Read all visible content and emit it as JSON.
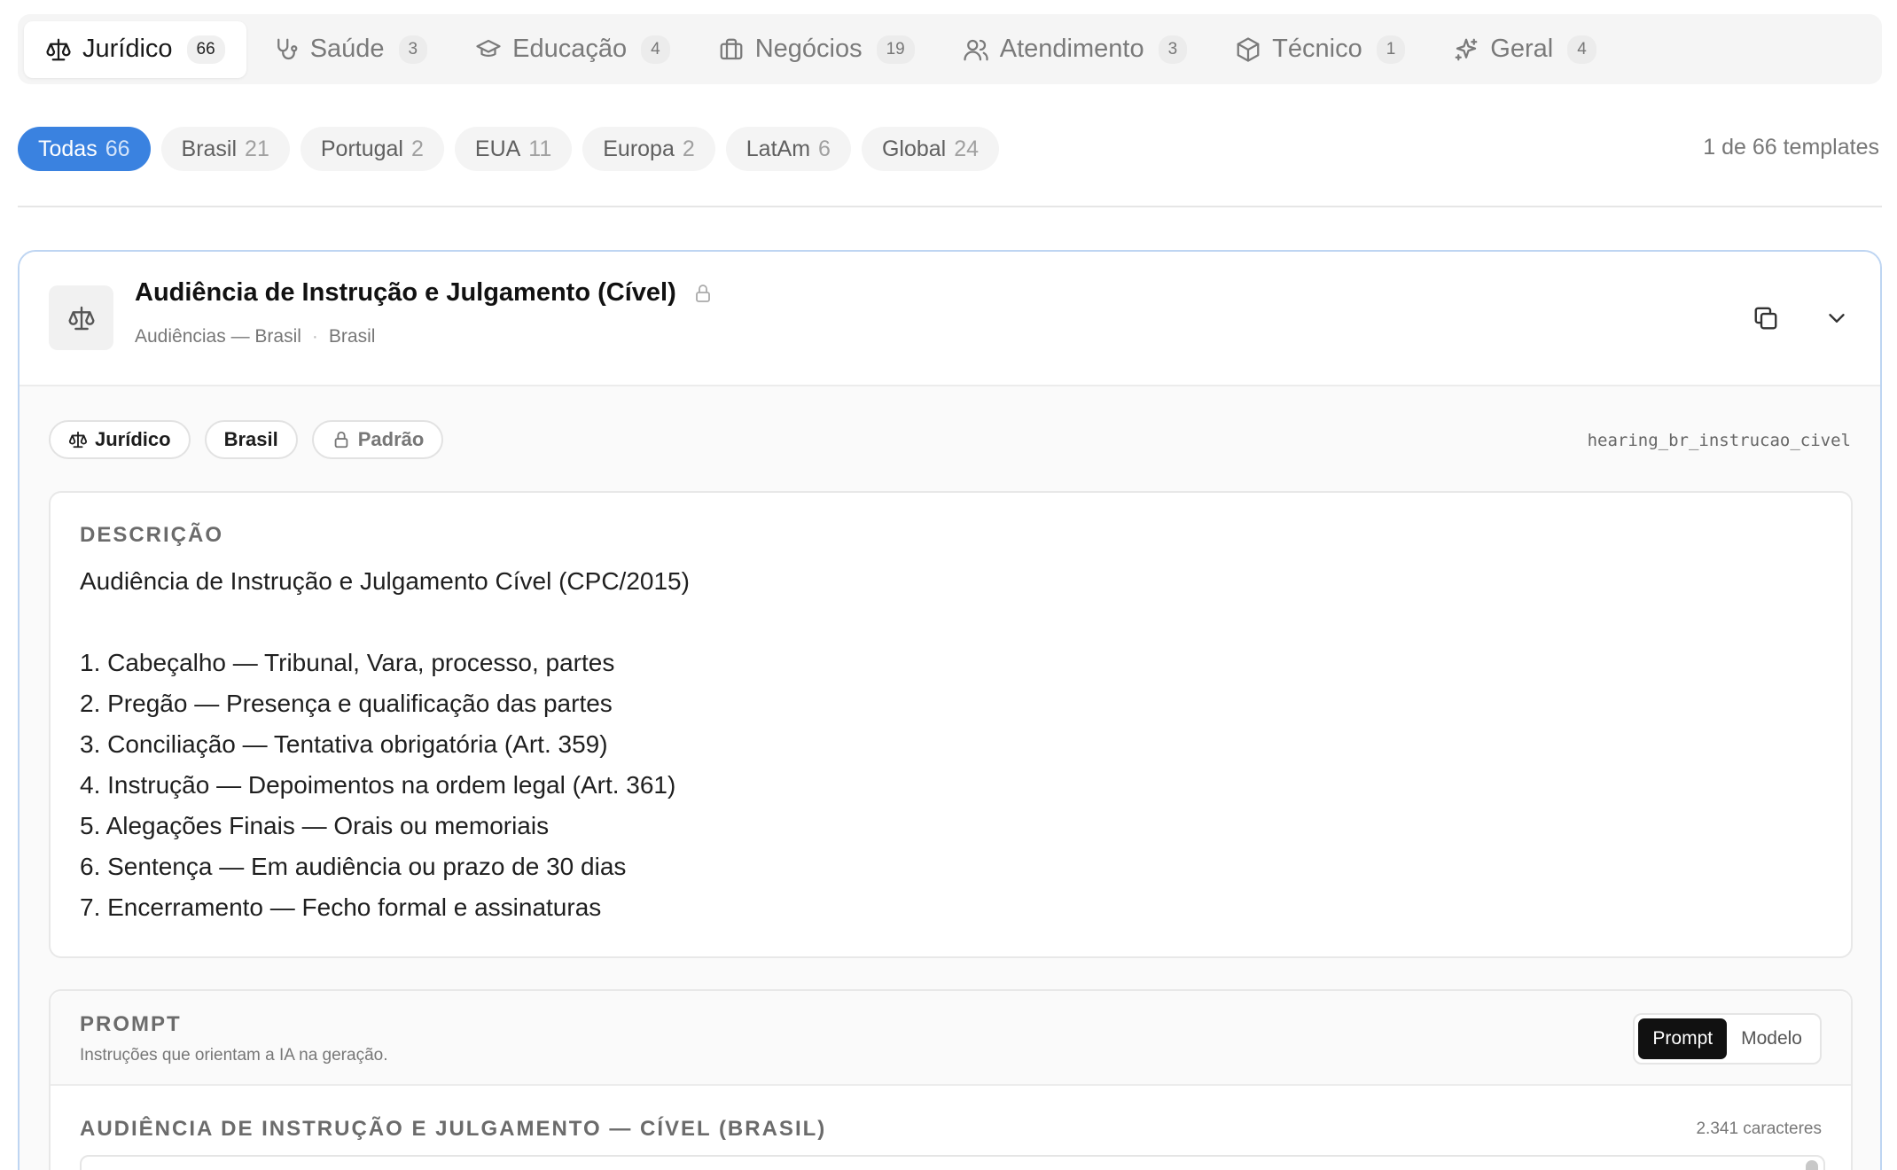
{
  "categories": [
    {
      "label": "Jurídico",
      "count": "66",
      "icon": "scale-icon",
      "active": true
    },
    {
      "label": "Saúde",
      "count": "3",
      "icon": "stethoscope-icon"
    },
    {
      "label": "Educação",
      "count": "4",
      "icon": "graduation-cap-icon"
    },
    {
      "label": "Negócios",
      "count": "19",
      "icon": "briefcase-icon"
    },
    {
      "label": "Atendimento",
      "count": "3",
      "icon": "users-icon"
    },
    {
      "label": "Técnico",
      "count": "1",
      "icon": "box-icon"
    },
    {
      "label": "Geral",
      "count": "4",
      "icon": "sparkles-icon"
    }
  ],
  "regions": [
    {
      "label": "Todas",
      "count": "66",
      "active": true
    },
    {
      "label": "Brasil",
      "count": "21"
    },
    {
      "label": "Portugal",
      "count": "2"
    },
    {
      "label": "EUA",
      "count": "11"
    },
    {
      "label": "Europa",
      "count": "2"
    },
    {
      "label": "LatAm",
      "count": "6"
    },
    {
      "label": "Global",
      "count": "24"
    }
  ],
  "template_count": "1 de 66 templates",
  "card": {
    "title": "Audiência de Instrução e Julgamento (Cível)",
    "subtitle_group": "Audiências — Brasil",
    "subtitle_region": "Brasil",
    "chips": {
      "category": "Jurídico",
      "region": "Brasil",
      "type": "Padrão"
    },
    "slug": "hearing_br_instrucao_civel",
    "description_label": "DESCRIÇÃO",
    "description_lines": [
      "Audiência de Instrução e Julgamento Cível (CPC/2015)",
      "",
      "1. Cabeçalho — Tribunal, Vara, processo, partes",
      "2. Pregão — Presença e qualificação das partes",
      "3. Conciliação — Tentativa obrigatória (Art. 359)",
      "4. Instrução — Depoimentos na ordem legal (Art. 361)",
      "5. Alegações Finais — Orais ou memoriais",
      "6. Sentença — Em audiência ou prazo de 30 dias",
      "7. Encerramento — Fecho formal e assinaturas"
    ],
    "prompt": {
      "label": "PROMPT",
      "subtitle": "Instruções que orientam a IA na geração.",
      "toggle_prompt": "Prompt",
      "toggle_model": "Modelo",
      "section_title": "AUDIÊNCIA DE INSTRUÇÃO E JULGAMENTO — CÍVEL (BRASIL)",
      "chars": "2.341 caracteres"
    }
  }
}
